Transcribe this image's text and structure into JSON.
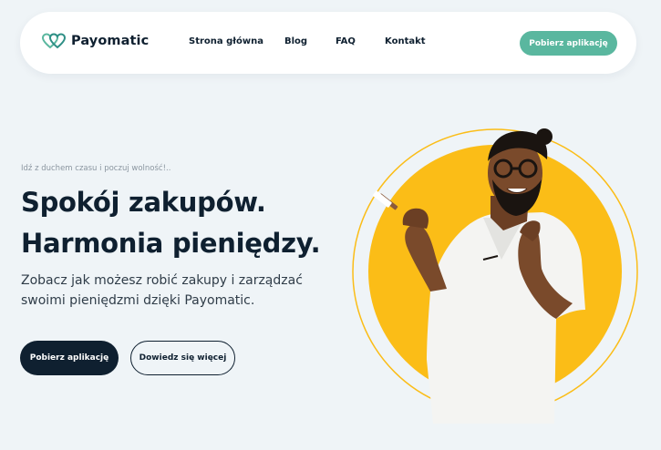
{
  "header": {
    "logo_text": "Payomatic",
    "logo_icon": "intertwined-hearts-icon",
    "nav": [
      {
        "label": "Strona główna"
      },
      {
        "label": "Blog"
      },
      {
        "label": "FAQ"
      },
      {
        "label": "Kontakt"
      }
    ],
    "cta_label": "Pobierz aplikację"
  },
  "hero": {
    "tagline": "Idź z duchem czasu i poczuj wolność!..",
    "headline_line1": "Spokój zakupów.",
    "headline_line2": "Harmonia pieniędzy.",
    "subtitle_line1": "Zobacz jak możesz robić zakupy i zarządzać",
    "subtitle_line2": "swoimi pieniędzmi dzięki Payomatic.",
    "primary_button": "Pobierz aplikację",
    "secondary_button": "Dowiedz się więcej",
    "image_icon": "man-holding-card-illustration"
  },
  "colors": {
    "background": "#eff4f7",
    "accent_green": "#5ab79f",
    "dark_navy": "#0f2030",
    "yellow_circle": "#fbbd17"
  }
}
